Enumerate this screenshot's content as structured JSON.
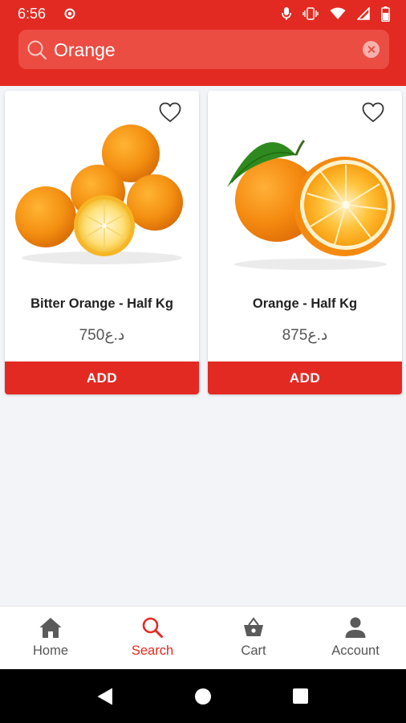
{
  "status": {
    "time": "6:56"
  },
  "search": {
    "value": "Orange",
    "placeholder": ""
  },
  "products": [
    {
      "name": "Bitter Orange - Half Kg",
      "price": "750د.ع",
      "add_label": "ADD"
    },
    {
      "name": "Orange - Half Kg",
      "price": "875د.ع",
      "add_label": "ADD"
    }
  ],
  "nav": {
    "items": [
      {
        "label": "Home",
        "icon": "home-icon"
      },
      {
        "label": "Search",
        "icon": "search-icon",
        "active": true
      },
      {
        "label": "Cart",
        "icon": "basket-icon"
      },
      {
        "label": "Account",
        "icon": "person-icon"
      }
    ]
  },
  "colors": {
    "brand": "#e32a22",
    "search_bg": "#ec4d43",
    "background": "#f2f4f8"
  }
}
